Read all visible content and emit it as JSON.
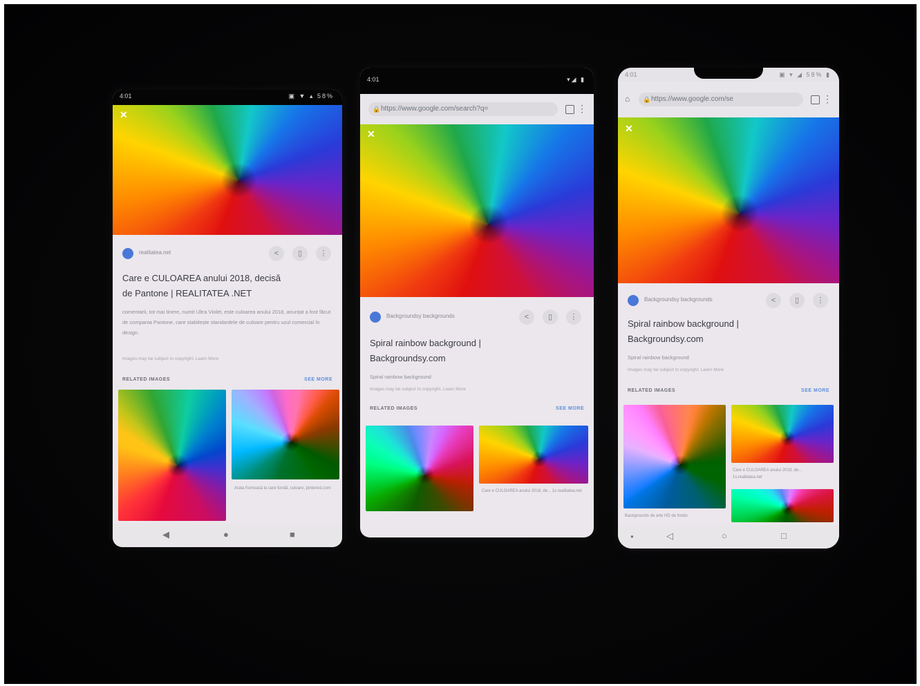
{
  "phones": [
    {
      "status_time": "4:01",
      "status_icons": "▣ ▼ ▴ 58%",
      "source": "realitatea.net",
      "title_line1": "Care e CULOAREA anului 2018, decisă",
      "title_line2": "de Pantone | REALITATEA .NET",
      "description": "comentarii, tot mai tinere, numit Ultra Violet, este culoarea anului 2018, anunțat a fost făcut de compania Pantone, care stabilește standardele de culoare pentru uzul comercial în design.",
      "copyright": "Images may be subject to copyright. Learn More",
      "related_label": "RELATED IMAGES",
      "see_more": "SEE MORE",
      "thumb_caption": "Arata frumoasă la care fundă, culoare, pinterest.com"
    },
    {
      "status_time": "4:01",
      "status_icons": "▾◢ ▮",
      "url": "https://www.google.com/search?q=",
      "source": "Backgroundsy backgrounds",
      "title_line1": "Spiral rainbow background |",
      "title_line2": "Backgroundsy.com",
      "subtitle": "Spiral rainbow background",
      "copyright": "Images may be subject to copyright. Learn More",
      "related_label": "RELATED IMAGES",
      "see_more": "SEE MORE",
      "thumb_caption": "Care e CULOAREA anului 2018, de... 1s.realitatea.net"
    },
    {
      "status_time": "4:01",
      "status_icons": "▣ ▾ ◢ 58% ▮",
      "url": "https://www.google.com/se",
      "source": "Backgroundsy backgrounds",
      "title_line1": "Spiral rainbow background |",
      "title_line2": "Backgroundsy.com",
      "subtitle": "Spiral rainbow background",
      "copyright": "Images may be subject to copyright. Learn More",
      "related_label": "RELATED IMAGES",
      "see_more": "SEE MORE",
      "thumb_caption_1": "Care e CULOAREA anului 2018, de... 1s.realitatea.net",
      "thumb_caption_2": "Backgrounds de arte HD de fondo"
    }
  ]
}
